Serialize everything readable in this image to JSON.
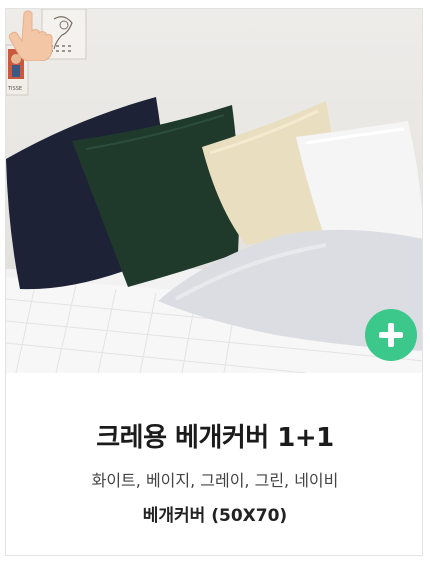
{
  "product": {
    "title": "크레용 베개커버 1+1",
    "colors": "화이트, 베이지, 그레이, 그린, 네이비",
    "size": "베개커버 (50X70)"
  },
  "poster": {
    "label": "TISSE"
  },
  "icons": {
    "add": "plus-circle-icon",
    "pointer": "tap-hand-icon"
  },
  "theme": {
    "accent": "#3cc88a",
    "navy": "#1d2236",
    "green": "#1f3a2b",
    "beige": "#e9dfc0",
    "white": "#f5f5f5",
    "gray": "#dcdde2"
  }
}
